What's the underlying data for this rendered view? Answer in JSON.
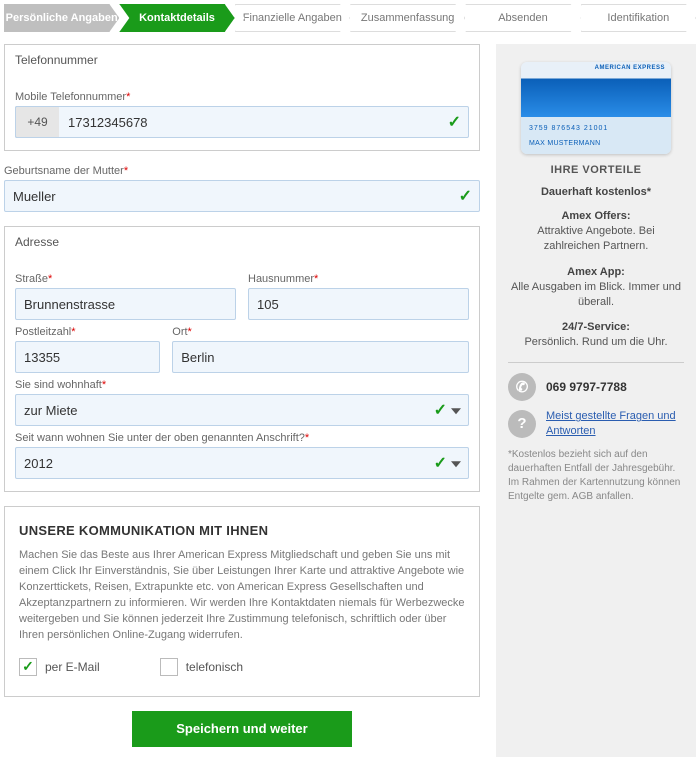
{
  "steps": [
    "Persönliche Angaben",
    "Kontaktdetails",
    "Finanzielle Angaben",
    "Zusammenfassung",
    "Absenden",
    "Identifikation"
  ],
  "phone": {
    "section": "Telefonnummer",
    "label": "Mobile Telefonnummer",
    "prefix": "+49",
    "value": "17312345678"
  },
  "mother": {
    "label": "Geburtsname der Mutter",
    "value": "Mueller"
  },
  "addr": {
    "section": "Adresse",
    "street_lbl": "Straße",
    "street": "Brunnenstrasse",
    "num_lbl": "Hausnummer",
    "num": "105",
    "zip_lbl": "Postleitzahl",
    "zip": "13355",
    "city_lbl": "Ort",
    "city": "Berlin",
    "res_lbl": "Sie sind wohnhaft",
    "res": "zur Miete",
    "since_lbl": "Seit wann wohnen Sie unter der oben genannten Anschrift?",
    "since": "2012"
  },
  "comm": {
    "title": "UNSERE KOMMUNIKATION MIT IHNEN",
    "text": "Machen Sie das Beste aus Ihrer American Express Mitgliedschaft und geben Sie uns mit einem Click Ihr Einverständnis, Sie über Leistungen Ihrer Karte und attraktive Angebote wie Konzerttickets, Reisen, Extrapunkte etc. von American Express Gesellschaften und Akzeptanzpartnern zu informieren. Wir werden Ihre Kontaktdaten niemals für Werbezwecke weitergeben und Sie können jederzeit Ihre Zustimmung telefonisch, schriftlich oder über Ihren persönlichen Online-Zugang widerrufen.",
    "email": "per E-Mail",
    "tel": "telefonisch"
  },
  "submit": "Speichern und weiter",
  "side": {
    "card_brand": "AMERICAN EXPRESS",
    "card_num": "3759 876543 21001",
    "card_name": "MAX MUSTERMANN",
    "head": "IHRE VORTEILE",
    "b1t": "Dauerhaft kostenlos*",
    "b2t": "Amex Offers:",
    "b2": "Attraktive Angebote.\nBei zahlreichen Partnern.",
    "b3t": "Amex App:",
    "b3": "Alle Ausgaben im Blick.\nImmer und überall.",
    "b4t": "24/7-Service:",
    "b4": "Persönlich. Rund um die Uhr.",
    "phone": "069 9797-7788",
    "faq": "Meist gestellte Fragen und Antworten",
    "note": "*Kostenlos bezieht sich auf den dauerhaften Entfall der Jahresgebühr. Im Rahmen der Kartennutzung können Entgelte gem. AGB anfallen."
  }
}
